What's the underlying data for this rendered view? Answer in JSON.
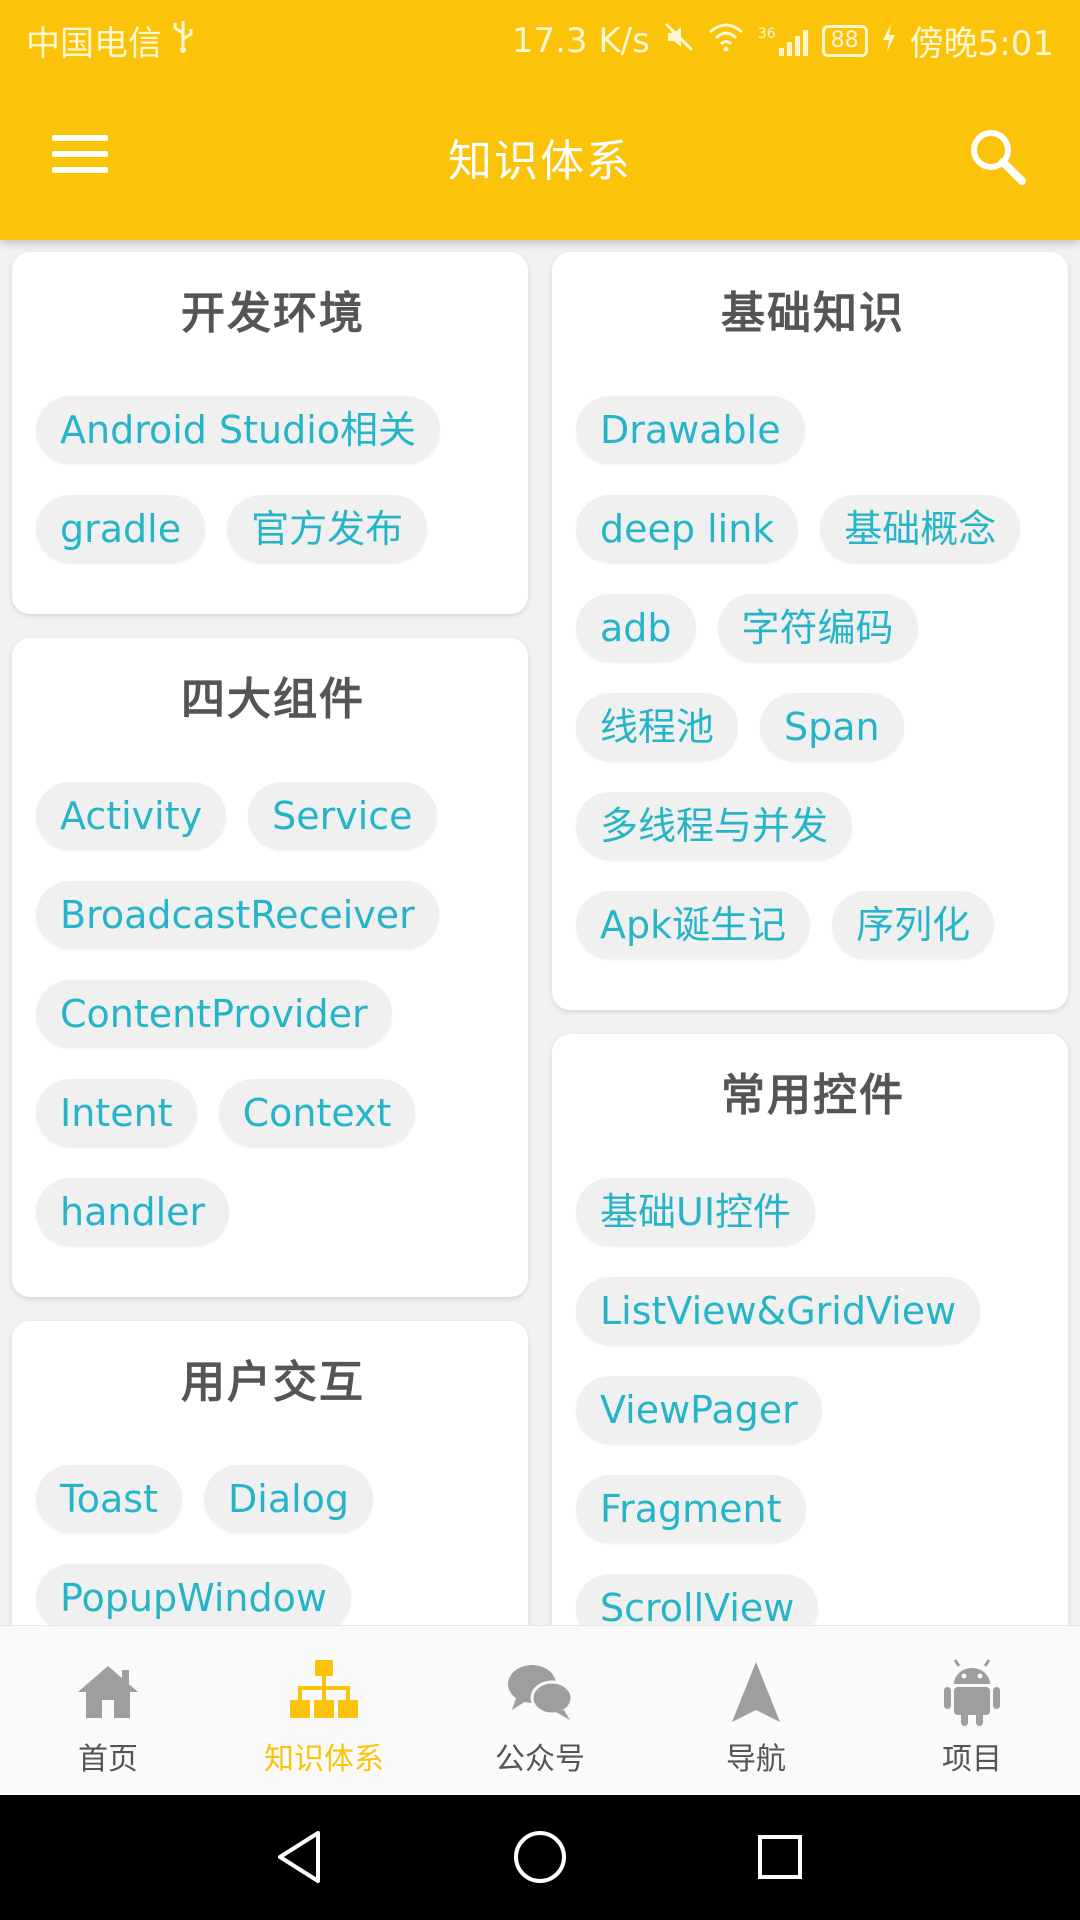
{
  "status_bar": {
    "carrier": "中国电信",
    "usb_icon": "usb-icon",
    "speed": "17.3 K/s",
    "network_label": "36",
    "battery": "88",
    "time": "傍晚5:01"
  },
  "toolbar": {
    "title": "知识体系",
    "menu_icon": "menu-icon",
    "search_icon": "search-icon"
  },
  "colors": {
    "accent": "#fbc40a",
    "tag_text": "#26b5c8",
    "tag_bg": "#f0f0f0",
    "title_text": "#555555"
  },
  "left_column": [
    {
      "title": "开发环境",
      "tags": [
        "Android Studio相关",
        "gradle",
        "官方发布"
      ]
    },
    {
      "title": "四大组件",
      "tags": [
        "Activity",
        "Service",
        "BroadcastReceiver",
        "ContentProvider",
        "Intent",
        "Context",
        "handler"
      ]
    },
    {
      "title": "用户交互",
      "tags": [
        "Toast",
        "Dialog",
        "PopupWindow"
      ]
    }
  ],
  "right_column": [
    {
      "title": "基础知识",
      "tags": [
        "Drawable",
        "deep link",
        "基础概念",
        "adb",
        "字符编码",
        "线程池",
        "Span",
        "多线程与并发",
        "Apk诞生记",
        "序列化"
      ]
    },
    {
      "title": "常用控件",
      "tags": [
        "基础UI控件",
        "ListView&GridView",
        "ViewPager",
        "Fragment",
        "ScrollView"
      ]
    }
  ],
  "bottom_nav": [
    {
      "label": "首页",
      "icon": "home-icon",
      "active": false
    },
    {
      "label": "知识体系",
      "icon": "hierarchy-icon",
      "active": true
    },
    {
      "label": "公众号",
      "icon": "chat-bubbles-icon",
      "active": false
    },
    {
      "label": "导航",
      "icon": "navigation-arrow-icon",
      "active": false
    },
    {
      "label": "项目",
      "icon": "android-icon",
      "active": false
    }
  ],
  "system_nav": [
    "back-icon",
    "home-circle-icon",
    "recents-icon"
  ]
}
